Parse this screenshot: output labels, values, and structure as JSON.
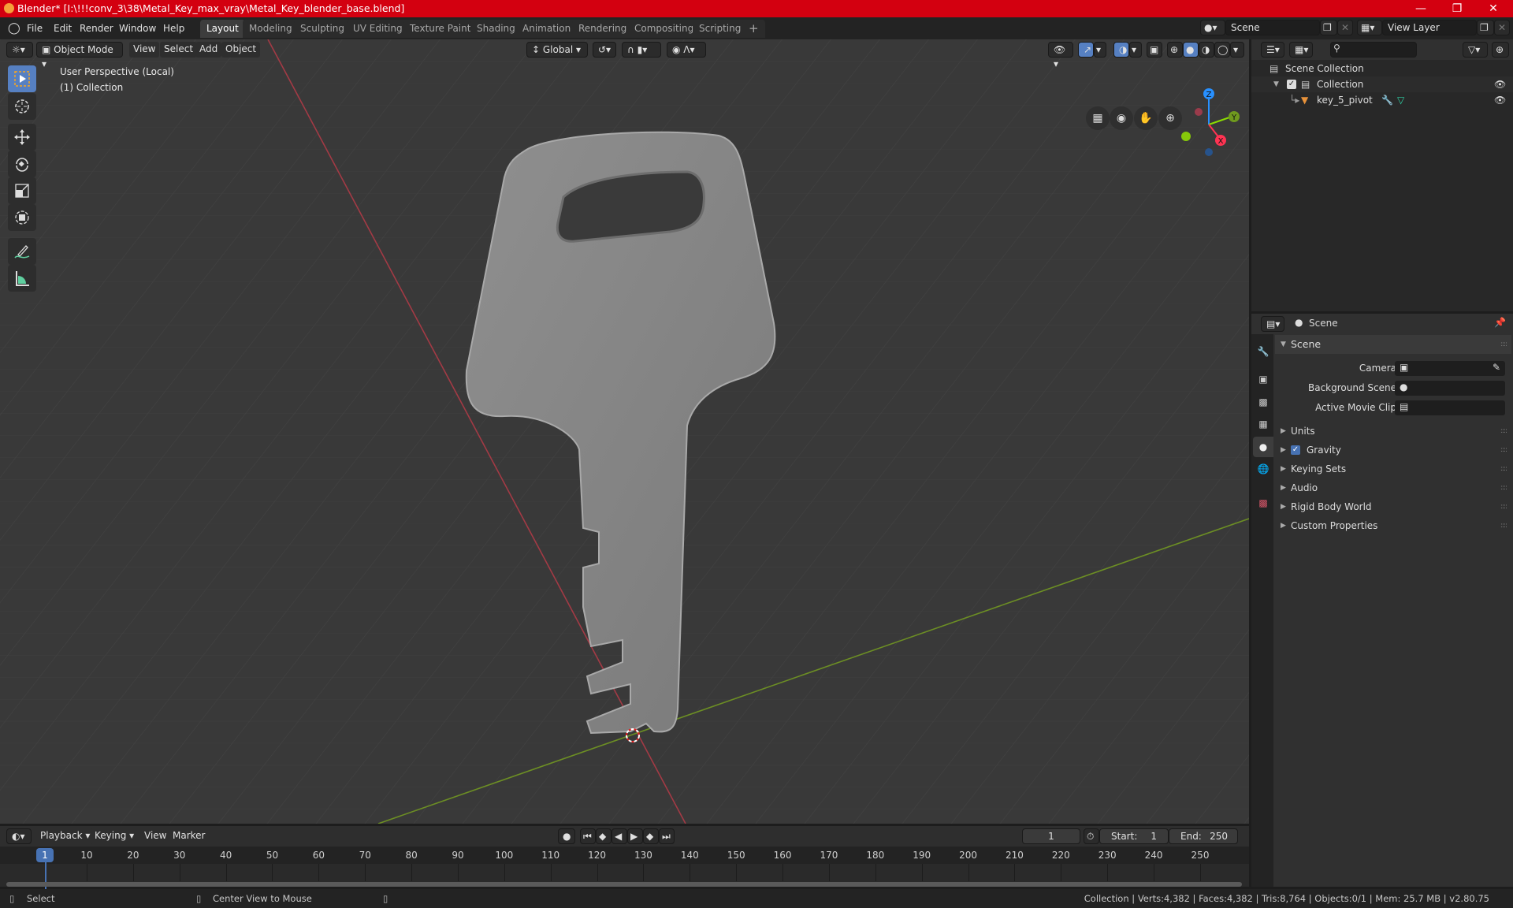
{
  "window": {
    "title": "Blender* [I:\\!!!conv_3\\38\\Metal_Key_max_vray\\Metal_Key_blender_base.blend]",
    "controls": [
      "minimize",
      "maximize",
      "close"
    ]
  },
  "menubar": {
    "menus": [
      "File",
      "Edit",
      "Render",
      "Window",
      "Help"
    ],
    "workspaces": [
      "Layout",
      "Modeling",
      "Sculpting",
      "UV Editing",
      "Texture Paint",
      "Shading",
      "Animation",
      "Rendering",
      "Compositing",
      "Scripting"
    ],
    "active_workspace": "Layout",
    "add_workspace_label": "+",
    "scene_name": "Scene",
    "view_layer_name": "View Layer"
  },
  "viewport": {
    "mode": "Object Mode",
    "menus": [
      "View",
      "Select",
      "Add",
      "Object"
    ],
    "orientation": "Global",
    "overlay_text_line1": "User Perspective (Local)",
    "overlay_text_line2": "(1) Collection",
    "tools": [
      "select-box",
      "cursor",
      "move",
      "rotate",
      "scale",
      "transform",
      "annotate",
      "measure"
    ],
    "active_tool": "select-box",
    "shading_modes": [
      "wireframe",
      "solid",
      "material-preview",
      "rendered"
    ],
    "active_shading": "solid",
    "gizmo_axes": [
      "X",
      "Y",
      "Z"
    ],
    "axis_colors": {
      "x": "#ff3352",
      "y": "#8bdc00",
      "z": "#2890ff"
    }
  },
  "outliner": {
    "search_placeholder": "",
    "root": "Scene Collection",
    "items": [
      {
        "name": "Collection",
        "type": "collection",
        "checked": true,
        "visible": true
      },
      {
        "name": "key_5_pivot",
        "type": "mesh-object",
        "visible": true,
        "badges": [
          "modifier",
          "mesh-data"
        ]
      }
    ]
  },
  "properties": {
    "context": "Scene",
    "tabs": [
      "tool",
      "render",
      "output",
      "view-layer",
      "scene",
      "world",
      "texture"
    ],
    "active_tab": "scene",
    "panels": [
      {
        "title": "Scene",
        "expanded": true,
        "fields": [
          {
            "label": "Camera",
            "value": ""
          },
          {
            "label": "Background Scene",
            "value": ""
          },
          {
            "label": "Active Movie Clip",
            "value": ""
          }
        ]
      },
      {
        "title": "Units",
        "expanded": false
      },
      {
        "title": "Gravity",
        "expanded": false,
        "checkbox": true
      },
      {
        "title": "Keying Sets",
        "expanded": false
      },
      {
        "title": "Audio",
        "expanded": false
      },
      {
        "title": "Rigid Body World",
        "expanded": false
      },
      {
        "title": "Custom Properties",
        "expanded": false
      }
    ]
  },
  "timeline": {
    "menus": [
      "Playback",
      "Keying",
      "View",
      "Marker"
    ],
    "current_frame": "1",
    "start_label": "Start:",
    "start": "1",
    "end_label": "End:",
    "end": "250",
    "ticks": [
      "10",
      "20",
      "30",
      "40",
      "50",
      "60",
      "70",
      "80",
      "90",
      "100",
      "110",
      "120",
      "130",
      "140",
      "150",
      "160",
      "170",
      "180",
      "190",
      "200",
      "210",
      "220",
      "230",
      "240",
      "250"
    ],
    "playhead_label": "1"
  },
  "statusbar": {
    "left_hint": "Select",
    "middle_hint": "Center View to Mouse",
    "stats": "Collection | Verts:4,382 | Faces:4,382 | Tris:8,764 | Objects:0/1 | Mem: 25.7 MB | v2.80.75"
  }
}
